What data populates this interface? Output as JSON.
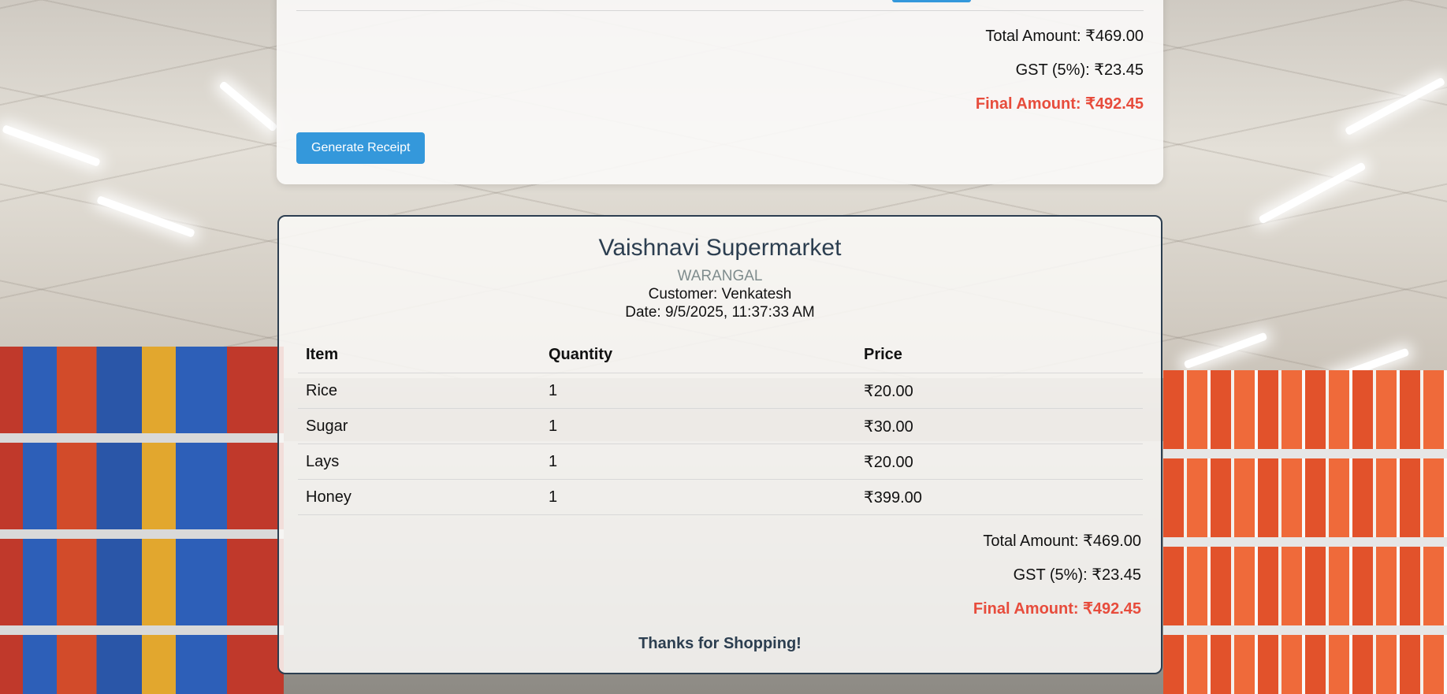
{
  "bill": {
    "total_label": "Total Amount: ₹469.00",
    "gst_label": "GST (5%): ₹23.45",
    "final_label": "Final Amount: ₹492.45",
    "generate_button": "Generate Receipt"
  },
  "receipt": {
    "store_name": "Vaishnavi Supermarket",
    "city": "WARANGAL",
    "customer": "Customer: Venkatesh",
    "date": "Date: 9/5/2025, 11:37:33 AM",
    "columns": [
      "Item",
      "Quantity",
      "Price"
    ],
    "rows": [
      {
        "item": "Rice",
        "quantity": "1",
        "price": "₹20.00"
      },
      {
        "item": "Sugar",
        "quantity": "1",
        "price": "₹30.00"
      },
      {
        "item": "Lays",
        "quantity": "1",
        "price": "₹20.00"
      },
      {
        "item": "Honey",
        "quantity": "1",
        "price": "₹399.00"
      }
    ],
    "total_label": "Total Amount: ₹469.00",
    "gst_label": "GST (5%): ₹23.45",
    "final_label": "Final Amount: ₹492.45",
    "thanks": "Thanks for Shopping!"
  },
  "colors": {
    "accent_blue": "#3498db",
    "final_red": "#e74c3c",
    "heading_navy": "#2c3e50"
  }
}
